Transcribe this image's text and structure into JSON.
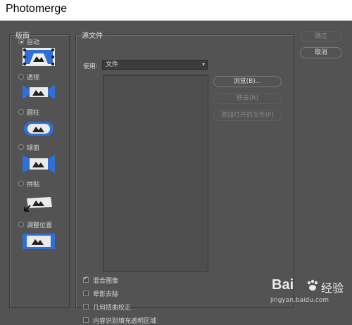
{
  "window": {
    "title": "Photomerge"
  },
  "layout": {
    "legend": "版面",
    "options": [
      {
        "label": "自动",
        "icon": "auto-layout-icon",
        "selected": true
      },
      {
        "label": "透视",
        "icon": "perspective-layout-icon",
        "selected": false
      },
      {
        "label": "圆柱",
        "icon": "cylindrical-layout-icon",
        "selected": false
      },
      {
        "label": "球面",
        "icon": "spherical-layout-icon",
        "selected": false
      },
      {
        "label": "拼贴",
        "icon": "collage-layout-icon",
        "selected": false
      },
      {
        "label": "调整位置",
        "icon": "reposition-layout-icon",
        "selected": false
      }
    ]
  },
  "source": {
    "legend": "源文件",
    "use_label": "使用:",
    "use_value": "文件",
    "buttons": {
      "browse": "浏览(B)...",
      "remove": "移去(R)",
      "add_open": "添加打开的文件(F)"
    },
    "checkboxes": [
      {
        "label": "混合图像",
        "checked": true
      },
      {
        "label": "晕影去除",
        "checked": false
      },
      {
        "label": "几何扭曲校正",
        "checked": false
      },
      {
        "label": "内容识别填充透明区域",
        "checked": false
      }
    ]
  },
  "actions": {
    "ok": "确定",
    "cancel": "取消"
  },
  "watermark": {
    "brand": "Bai",
    "brand2": "经验",
    "url": "jingyan.baidu.com"
  },
  "colors": {
    "accent_blue": "#2f6fd8",
    "panel": "#535353"
  }
}
